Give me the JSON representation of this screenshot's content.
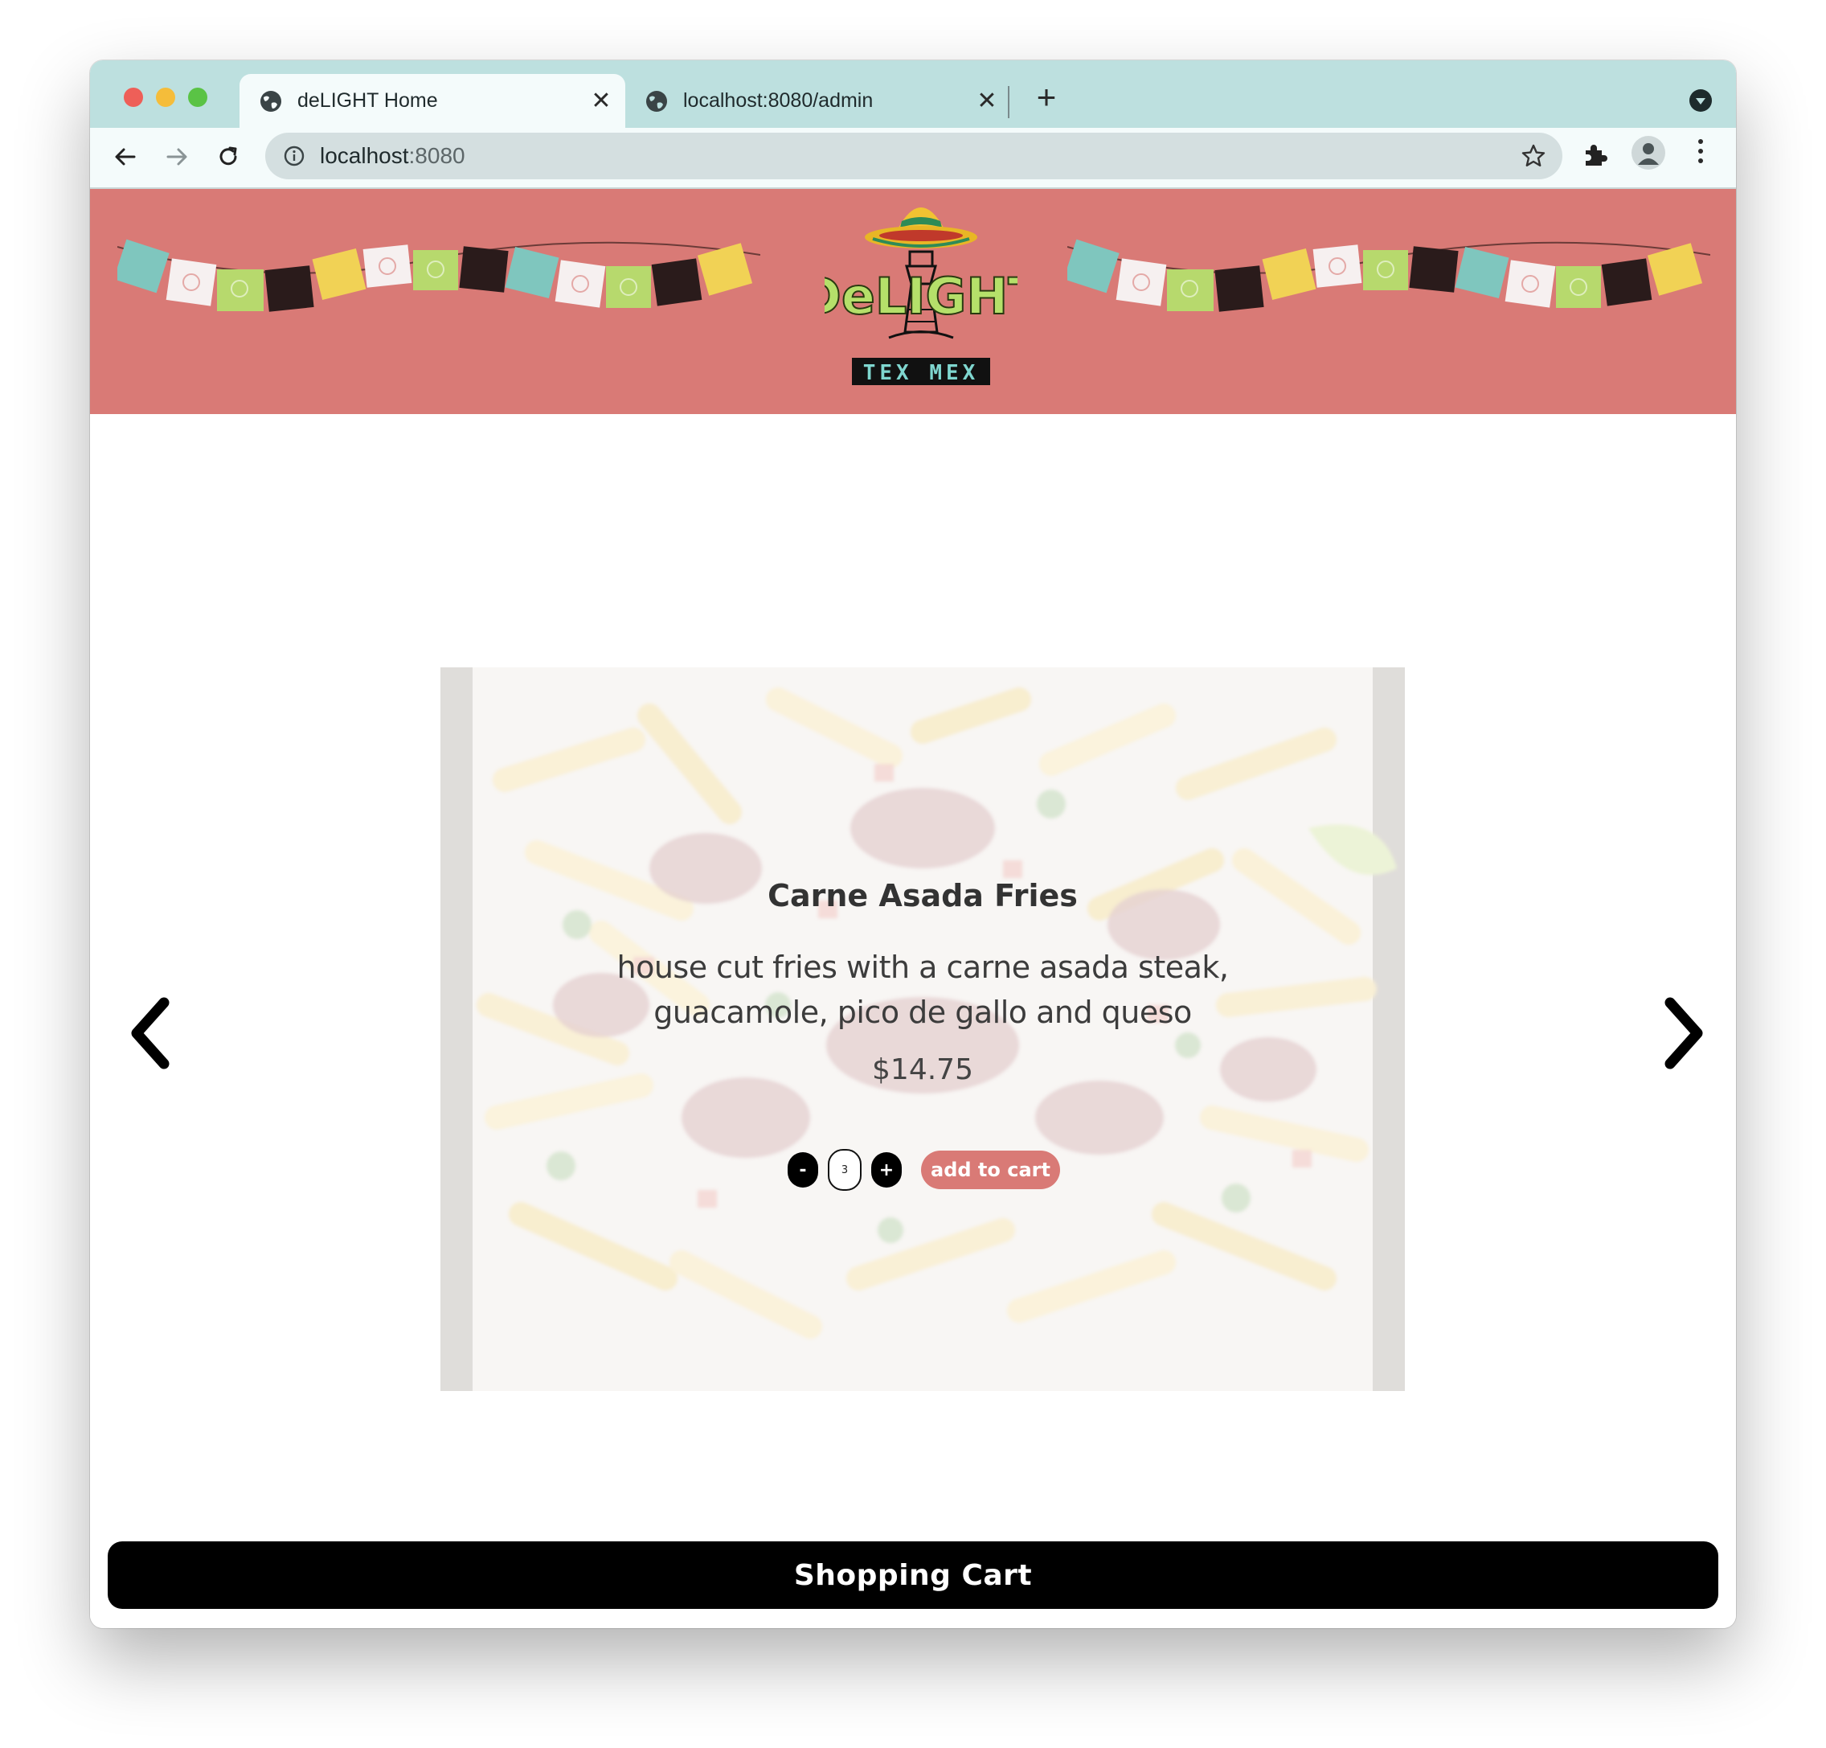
{
  "browser": {
    "tabs": [
      {
        "title": "deLIGHT Home",
        "active": true
      },
      {
        "title": "localhost:8080/admin",
        "active": false
      }
    ],
    "url_host": "localhost",
    "url_port": ":8080",
    "icons": {
      "tab_favicon": "globe-icon",
      "tab_close": "close-icon",
      "new_tab": "plus-icon",
      "tab_menu": "chevron-down-icon",
      "back": "arrow-left-icon",
      "forward": "arrow-right-icon",
      "reload": "reload-icon",
      "site_info": "info-icon",
      "bookmark": "star-icon",
      "extensions": "puzzle-icon",
      "profile": "person-icon",
      "menu": "kebab-icon"
    }
  },
  "header": {
    "logo_text_top": "DeLIGHT",
    "logo_text_bottom": "TEX MEX",
    "background": "#d97a76"
  },
  "carousel": {
    "item": {
      "name": "Carne Asada Fries",
      "description_line1": "house cut fries with a carne asada steak,",
      "description_line2": "guacamole, pico de gallo and queso",
      "price": "$14.75"
    },
    "quantity": {
      "decrement_label": "-",
      "value": "3",
      "increment_label": "+"
    },
    "add_to_cart_label": "add to cart",
    "prev_icon": "chevron-left-icon",
    "next_icon": "chevron-right-icon"
  },
  "cart": {
    "label": "Shopping Cart"
  },
  "colors": {
    "accent": "#d97a76",
    "tabstrip": "#bde0df",
    "cart_bar": "#000000"
  }
}
